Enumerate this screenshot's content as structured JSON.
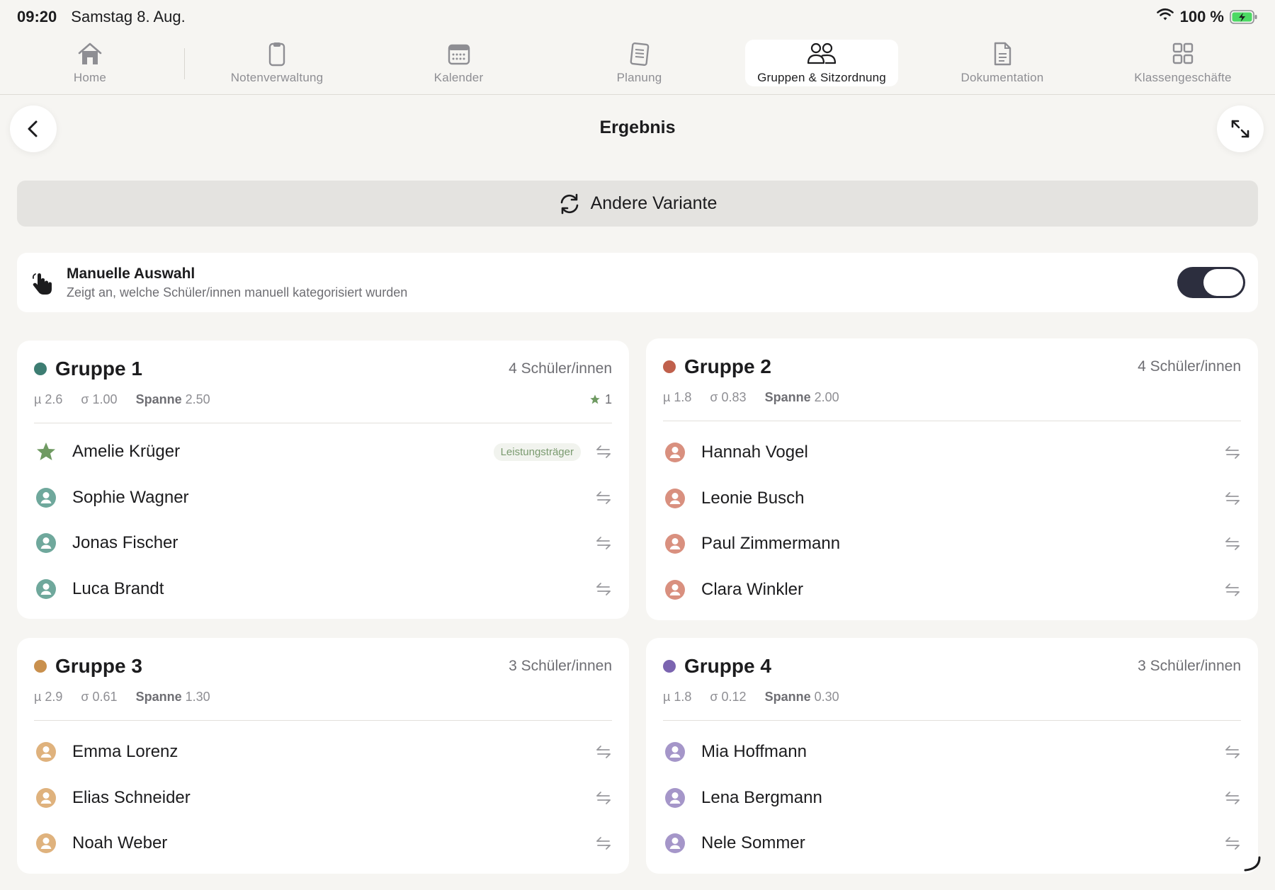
{
  "status": {
    "time": "09:20",
    "date": "Samstag 8. Aug.",
    "battery": "100 %"
  },
  "tabs": [
    {
      "label": "Home",
      "icon": "home-icon"
    },
    {
      "label": "Notenverwaltung",
      "icon": "clipboard-icon"
    },
    {
      "label": "Kalender",
      "icon": "calendar-icon"
    },
    {
      "label": "Planung",
      "icon": "notebook-icon"
    },
    {
      "label": "Gruppen & Sitzordnung",
      "icon": "people-icon",
      "active": true
    },
    {
      "label": "Dokumentation",
      "icon": "document-icon"
    },
    {
      "label": "Klassengeschäfte",
      "icon": "grid-icon"
    }
  ],
  "header": {
    "title": "Ergebnis"
  },
  "variant_button": {
    "label": "Andere Variante"
  },
  "manual": {
    "title": "Manuelle Auswahl",
    "subtitle": "Zeigt an, welche Schüler/innen manuell kategorisiert wurden",
    "enabled": true
  },
  "groups": [
    {
      "name": "Gruppe 1",
      "color": "#3d7d72",
      "count": "4 Schüler/innen",
      "mu": "µ 2.6",
      "sigma": "σ 1.00",
      "span_label": "Spanne",
      "span": "2.50",
      "star_count": "1",
      "students": [
        {
          "name": "Amelie Krüger",
          "star": true,
          "badge": "Leistungsträger"
        },
        {
          "name": "Sophie Wagner"
        },
        {
          "name": "Jonas Fischer"
        },
        {
          "name": "Luca Brandt"
        }
      ]
    },
    {
      "name": "Gruppe 2",
      "color": "#c0604c",
      "count": "4 Schüler/innen",
      "mu": "µ 1.8",
      "sigma": "σ 0.83",
      "span_label": "Spanne",
      "span": "2.00",
      "students": [
        {
          "name": "Hannah Vogel"
        },
        {
          "name": "Leonie Busch"
        },
        {
          "name": "Paul Zimmermann"
        },
        {
          "name": "Clara Winkler"
        }
      ]
    },
    {
      "name": "Gruppe 3",
      "color": "#c9904d",
      "count": "3 Schüler/innen",
      "mu": "µ 2.9",
      "sigma": "σ 0.61",
      "span_label": "Spanne",
      "span": "1.30",
      "students": [
        {
          "name": "Emma Lorenz"
        },
        {
          "name": "Elias Schneider"
        },
        {
          "name": "Noah Weber"
        }
      ]
    },
    {
      "name": "Gruppe 4",
      "color": "#7b64b0",
      "count": "3 Schüler/innen",
      "mu": "µ 1.8",
      "sigma": "σ 0.12",
      "span_label": "Spanne",
      "span": "0.30",
      "students": [
        {
          "name": "Mia Hoffmann"
        },
        {
          "name": "Lena Bergmann"
        },
        {
          "name": "Nele Sommer"
        }
      ]
    }
  ],
  "colors": {
    "group1_avatar": "#6fa89c",
    "group2_avatar": "#d9907f",
    "group3_avatar": "#dfb27d",
    "group4_avatar": "#a596c9",
    "star": "#6f9a62"
  }
}
